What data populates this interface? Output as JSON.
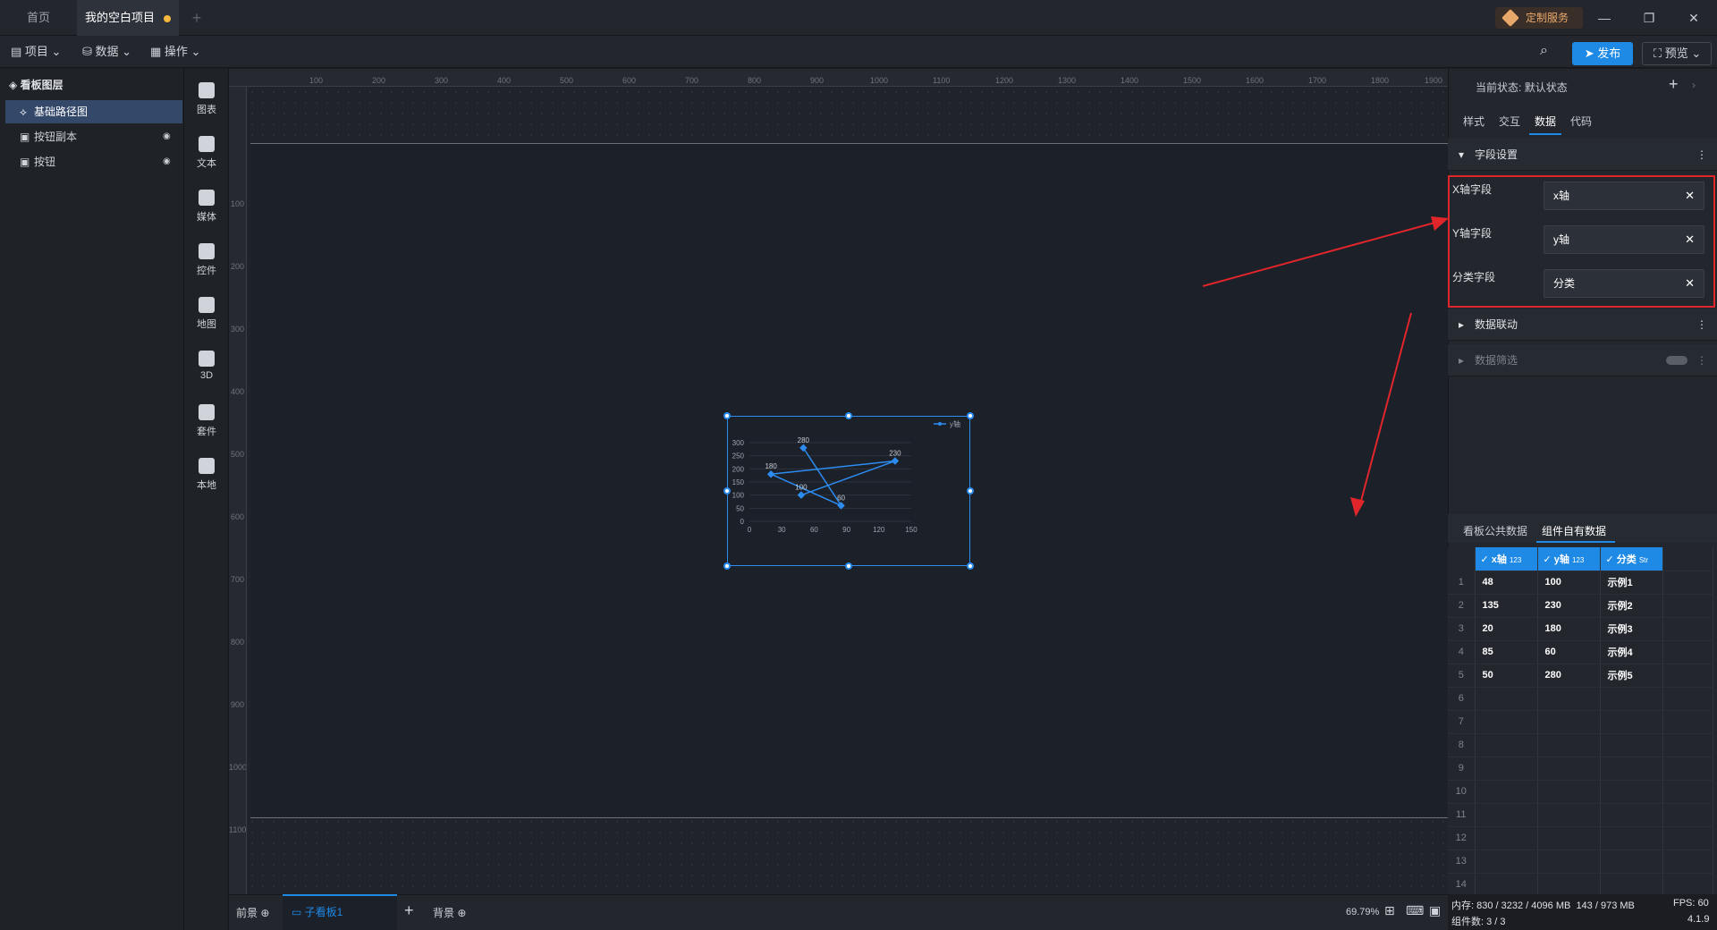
{
  "tabs": {
    "home": "首页",
    "project": "我的空白项目",
    "custom_service": "定制服务"
  },
  "toolbar": {
    "project": "项目",
    "data": "数据",
    "operation": "操作",
    "publish": "发布",
    "preview": "预览"
  },
  "layers": {
    "title": "看板图层",
    "items": [
      {
        "label": "基础路径图"
      },
      {
        "label": "按钮副本"
      },
      {
        "label": "按钮"
      }
    ]
  },
  "components": [
    {
      "label": "图表",
      "icon": "bar-chart-icon"
    },
    {
      "label": "文本",
      "icon": "text-icon"
    },
    {
      "label": "媒体",
      "icon": "media-icon"
    },
    {
      "label": "控件",
      "icon": "control-icon"
    },
    {
      "label": "地图",
      "icon": "map-icon"
    },
    {
      "label": "3D",
      "icon": "cube-icon"
    },
    {
      "label": "套件",
      "icon": "kit-icon"
    },
    {
      "label": "本地",
      "icon": "puzzle-icon"
    }
  ],
  "ruler": {
    "top": [
      "100",
      "200",
      "300",
      "400",
      "500",
      "600",
      "700",
      "800",
      "900",
      "1000",
      "1100",
      "1200",
      "1300",
      "1400",
      "1500",
      "1600",
      "1700",
      "1800",
      "1900"
    ],
    "left": [
      "100",
      "200",
      "300",
      "400",
      "500",
      "600",
      "700",
      "800",
      "900",
      "1000",
      "1100"
    ]
  },
  "chart_data": {
    "type": "line",
    "legend": "y轴",
    "points": [
      {
        "x": 48,
        "y": 100,
        "label": "100"
      },
      {
        "x": 135,
        "y": 230,
        "label": "230"
      },
      {
        "x": 20,
        "y": 180,
        "label": "180"
      },
      {
        "x": 85,
        "y": 60,
        "label": "60"
      },
      {
        "x": 50,
        "y": 280,
        "label": "280"
      }
    ],
    "xticks": [
      "0",
      "30",
      "60",
      "90",
      "120",
      "150"
    ],
    "yticks": [
      "0",
      "50",
      "100",
      "150",
      "200",
      "250",
      "300"
    ],
    "xlim": [
      0,
      150
    ],
    "ylim": [
      0,
      300
    ]
  },
  "right_panel": {
    "state_label": "当前状态:",
    "state_value": "默认状态",
    "tabs": [
      "样式",
      "交互",
      "数据",
      "代码"
    ],
    "field_settings": "字段设置",
    "fields": [
      {
        "label": "X轴字段",
        "value": "x轴"
      },
      {
        "label": "Y轴字段",
        "value": "y轴"
      },
      {
        "label": "分类字段",
        "value": "分类"
      }
    ],
    "data_linkage": "数据联动",
    "data_filter": "数据筛选",
    "data_tabs": [
      "看板公共数据",
      "组件自有数据"
    ],
    "table": {
      "columns": [
        {
          "name": "x轴",
          "type": "123"
        },
        {
          "name": "y轴",
          "type": "123"
        },
        {
          "name": "分类",
          "type": "Str"
        }
      ],
      "rows": [
        [
          "48",
          "100",
          "示例1"
        ],
        [
          "135",
          "230",
          "示例2"
        ],
        [
          "20",
          "180",
          "示例3"
        ],
        [
          "85",
          "60",
          "示例4"
        ],
        [
          "50",
          "280",
          "示例5"
        ]
      ],
      "row_numbers": [
        "1",
        "2",
        "3",
        "4",
        "5",
        "6",
        "7",
        "8",
        "9",
        "10",
        "11",
        "12",
        "13",
        "14"
      ]
    }
  },
  "bottom": {
    "front": "前景",
    "sub_board": "子看板1",
    "background": "背景",
    "zoom": "69.79%"
  },
  "status": {
    "memory_label": "内存:",
    "memory_value": "830 / 3232 / 4096 MB",
    "memory_value2": "143 / 973 MB",
    "fps_label": "FPS:",
    "fps_value": "60",
    "component_count": "组件数: 3 / 3",
    "version": "4.1.9"
  },
  "colors": {
    "accent": "#1f8ae6",
    "highlight_red": "#e0262b",
    "chart_line": "#2d8cf0"
  }
}
